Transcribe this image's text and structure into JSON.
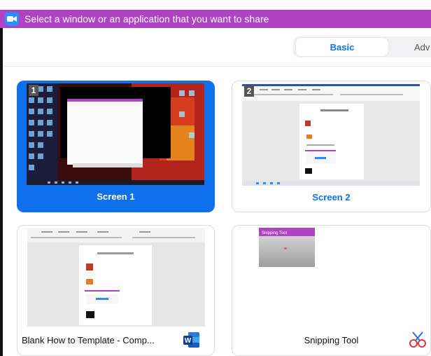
{
  "window": {
    "title": "Select a window or an application that you want to share"
  },
  "tabs": {
    "basic": "Basic",
    "advanced": "Adv"
  },
  "cards": [
    {
      "label": "Screen 1",
      "number": "1",
      "selected": true
    },
    {
      "label": "Screen 2",
      "number": "2",
      "selected": false
    },
    {
      "label": "Blank How to Template  -  Comp...",
      "app_icon": "word-icon",
      "selected": false
    },
    {
      "label": "Snipping Tool",
      "app_icon": "snipping-tool-icon",
      "selected": false
    }
  ],
  "colors": {
    "accent": "#0e71eb",
    "titlebar": "#b043c3"
  }
}
